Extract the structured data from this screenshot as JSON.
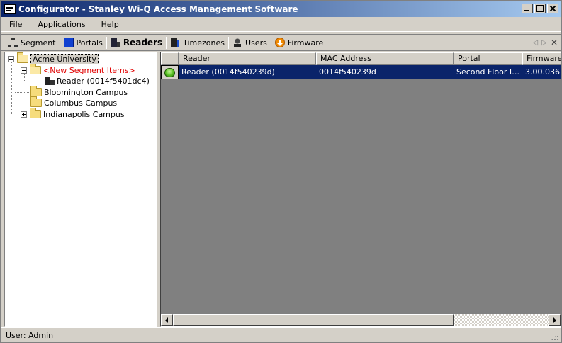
{
  "window": {
    "title": "Configurator - Stanley Wi-Q Access Management Software"
  },
  "menu": [
    {
      "label": "File"
    },
    {
      "label": "Applications"
    },
    {
      "label": "Help"
    }
  ],
  "tabs": [
    {
      "label": "Segment",
      "icon": "segment-icon"
    },
    {
      "label": "Portals",
      "icon": "portals-icon"
    },
    {
      "label": "Readers",
      "icon": "readers-icon",
      "active": true
    },
    {
      "label": "Timezones",
      "icon": "timezones-icon"
    },
    {
      "label": "Users",
      "icon": "users-icon"
    },
    {
      "label": "Firmware",
      "icon": "firmware-icon"
    }
  ],
  "tree": {
    "root": "Acme University",
    "new_segment_items": "<New Segment Items>",
    "reader_node": "Reader (0014f5401dc4)",
    "campus1": "Bloomington Campus",
    "campus2": "Columbus Campus",
    "campus3": "Indianapolis Campus"
  },
  "grid": {
    "columns": [
      "",
      "Reader",
      "MAC Address",
      "Portal",
      "Firmware Version"
    ],
    "rows": [
      {
        "status": "online",
        "reader": "Reader (0014f540239d)",
        "mac": "0014f540239d",
        "portal": "Second Floor IT Office",
        "firmware": "3.00.036"
      }
    ]
  },
  "status": {
    "text": "User: Admin"
  },
  "colors": {
    "titlebar_start": "#0a246a",
    "selection": "#0a246a",
    "new_items_text": "#e00000"
  }
}
